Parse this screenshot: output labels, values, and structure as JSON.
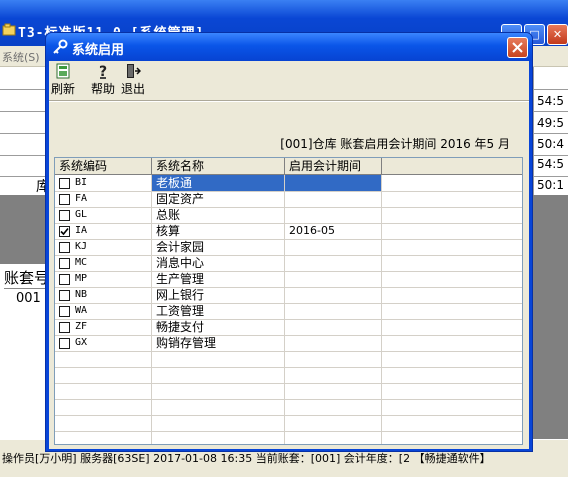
{
  "background": {
    "title": "T3-标准版11.0 [系统管理]",
    "menu": "系统(S)",
    "times": [
      "54:5",
      "49:5",
      "50:4",
      "54:5",
      "50:1"
    ],
    "side_label": "库",
    "panel_header": "账套号",
    "panel_value": "001",
    "status_bar": "操作员[万小明]   服务器[63SE]   2017-01-08 16:35   当前账套：[001] 会计年度：[2   【畅捷通软件】"
  },
  "dialog": {
    "title": "系统启用",
    "toolbar": {
      "refresh_label": "刷新",
      "help_label": "帮助",
      "exit_label": "退出"
    },
    "info": "[001]仓库 账套启用会计期间 2016 年5 月",
    "columns": [
      "系统编码",
      "系统名称",
      "启用会计期间"
    ],
    "rows": [
      {
        "code": "BI",
        "name": "老板通",
        "period": "",
        "checked": false,
        "selected": true
      },
      {
        "code": "FA",
        "name": "固定资产",
        "period": "",
        "checked": false,
        "selected": false
      },
      {
        "code": "GL",
        "name": "总账",
        "period": "",
        "checked": false,
        "selected": false
      },
      {
        "code": "IA",
        "name": "核算",
        "period": "2016-05",
        "checked": true,
        "selected": false
      },
      {
        "code": "KJ",
        "name": "会计家园",
        "period": "",
        "checked": false,
        "selected": false
      },
      {
        "code": "MC",
        "name": "消息中心",
        "period": "",
        "checked": false,
        "selected": false
      },
      {
        "code": "MP",
        "name": "生产管理",
        "period": "",
        "checked": false,
        "selected": false
      },
      {
        "code": "NB",
        "name": "网上银行",
        "period": "",
        "checked": false,
        "selected": false
      },
      {
        "code": "WA",
        "name": "工资管理",
        "period": "",
        "checked": false,
        "selected": false
      },
      {
        "code": "ZF",
        "name": "畅捷支付",
        "period": "",
        "checked": false,
        "selected": false
      },
      {
        "code": "GX",
        "name": "购销存管理",
        "period": "",
        "checked": false,
        "selected": false
      }
    ]
  }
}
